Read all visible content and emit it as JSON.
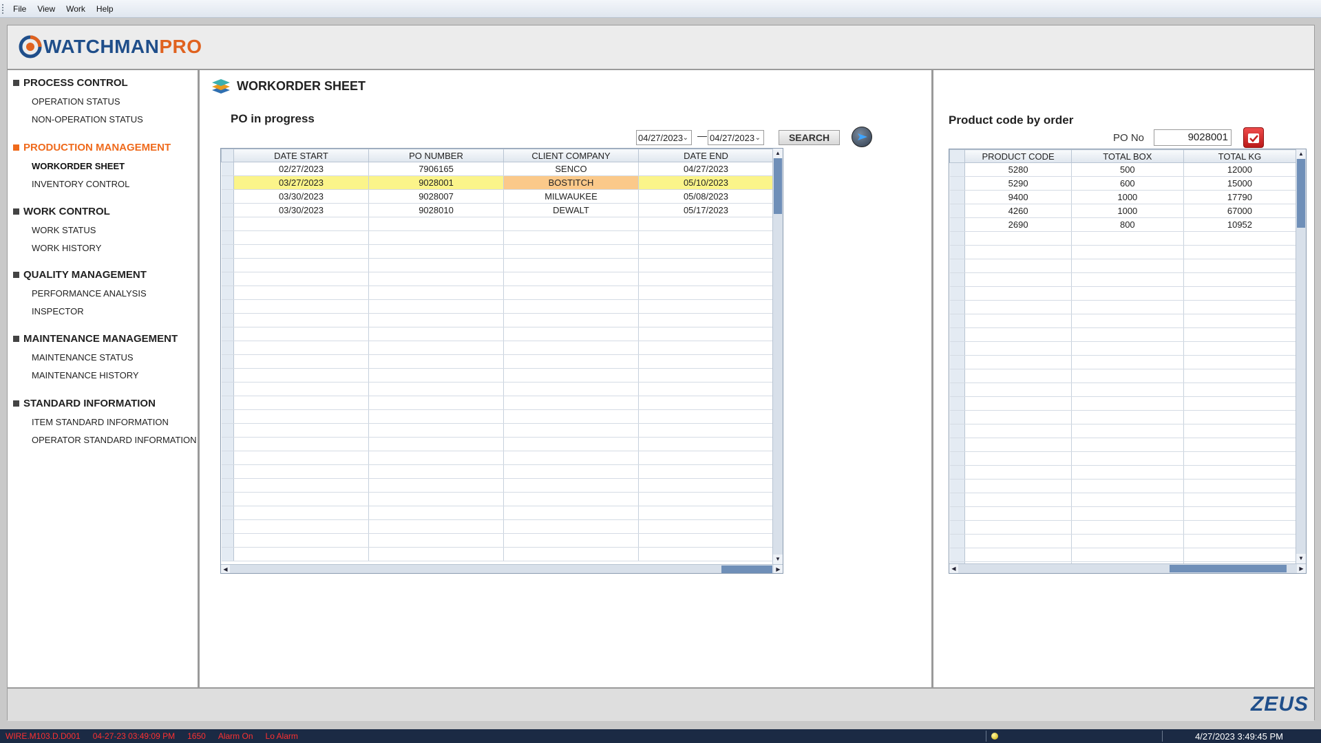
{
  "menu": [
    "File",
    "View",
    "Work",
    "Help"
  ],
  "logo": {
    "part1": "WATCHMAN",
    "part2": "PRO"
  },
  "sidebar": [
    {
      "title": "PROCESS CONTROL",
      "active": false,
      "items": [
        "OPERATION STATUS",
        "NON-OPERATION STATUS"
      ]
    },
    {
      "title": "PRODUCTION MANAGEMENT",
      "active": true,
      "items": [
        "WORKORDER SHEET",
        "INVENTORY CONTROL"
      ]
    },
    {
      "title": "WORK CONTROL",
      "active": false,
      "items": [
        "WORK STATUS",
        "WORK HISTORY"
      ]
    },
    {
      "title": "QUALITY MANAGEMENT",
      "active": false,
      "items": [
        "PERFORMANCE ANALYSIS",
        "INSPECTOR"
      ]
    },
    {
      "title": "MAINTENANCE MANAGEMENT",
      "active": false,
      "items": [
        "MAINTENANCE STATUS",
        "MAINTENANCE HISTORY"
      ]
    },
    {
      "title": "STANDARD INFORMATION",
      "active": false,
      "items": [
        "ITEM STANDARD INFORMATION",
        "OPERATOR STANDARD INFORMATION"
      ]
    }
  ],
  "active_item": "WORKORDER SHEET",
  "center": {
    "title": "WORKORDER SHEET",
    "subtitle": "PO in progress",
    "date_from": "04/27/2023",
    "date_separator": "—",
    "date_to": "04/27/2023",
    "search_label": "SEARCH",
    "columns": [
      "DATE START",
      "PO NUMBER",
      "CLIENT COMPANY",
      "DATE END"
    ],
    "rows": [
      [
        "02/27/2023",
        "7906165",
        "SENCO",
        "04/27/2023"
      ],
      [
        "03/27/2023",
        "9028001",
        "BOSTITCH",
        "05/10/2023"
      ],
      [
        "03/30/2023",
        "9028007",
        "MILWAUKEE",
        "05/08/2023"
      ],
      [
        "03/30/2023",
        "9028010",
        "DEWALT",
        "05/17/2023"
      ]
    ],
    "selected_row": 1
  },
  "right": {
    "title": "Product code by order",
    "po_label": "PO No",
    "po_value": "9028001",
    "columns": [
      "PRODUCT CODE",
      "TOTAL BOX",
      "TOTAL KG"
    ],
    "rows": [
      [
        "5280",
        "500",
        "12000"
      ],
      [
        "5290",
        "600",
        "15000"
      ],
      [
        "9400",
        "1000",
        "17790"
      ],
      [
        "4260",
        "1000",
        "67000"
      ],
      [
        "2690",
        "800",
        "10952"
      ]
    ]
  },
  "footer_brand": "ZEUS",
  "statusbar": {
    "device": "WIRE.M103.D.D001",
    "timestamp": "04-27-23 03:49:09 PM",
    "code": "1650",
    "alarm": "Alarm On",
    "level": "Lo Alarm",
    "clock": "4/27/2023 3:49:45 PM"
  },
  "colors": {
    "accent": "#ef6a1c",
    "brand": "#1f4e8a",
    "selected_row": "#fbf48a",
    "selected_cell": "#fbc98a"
  }
}
